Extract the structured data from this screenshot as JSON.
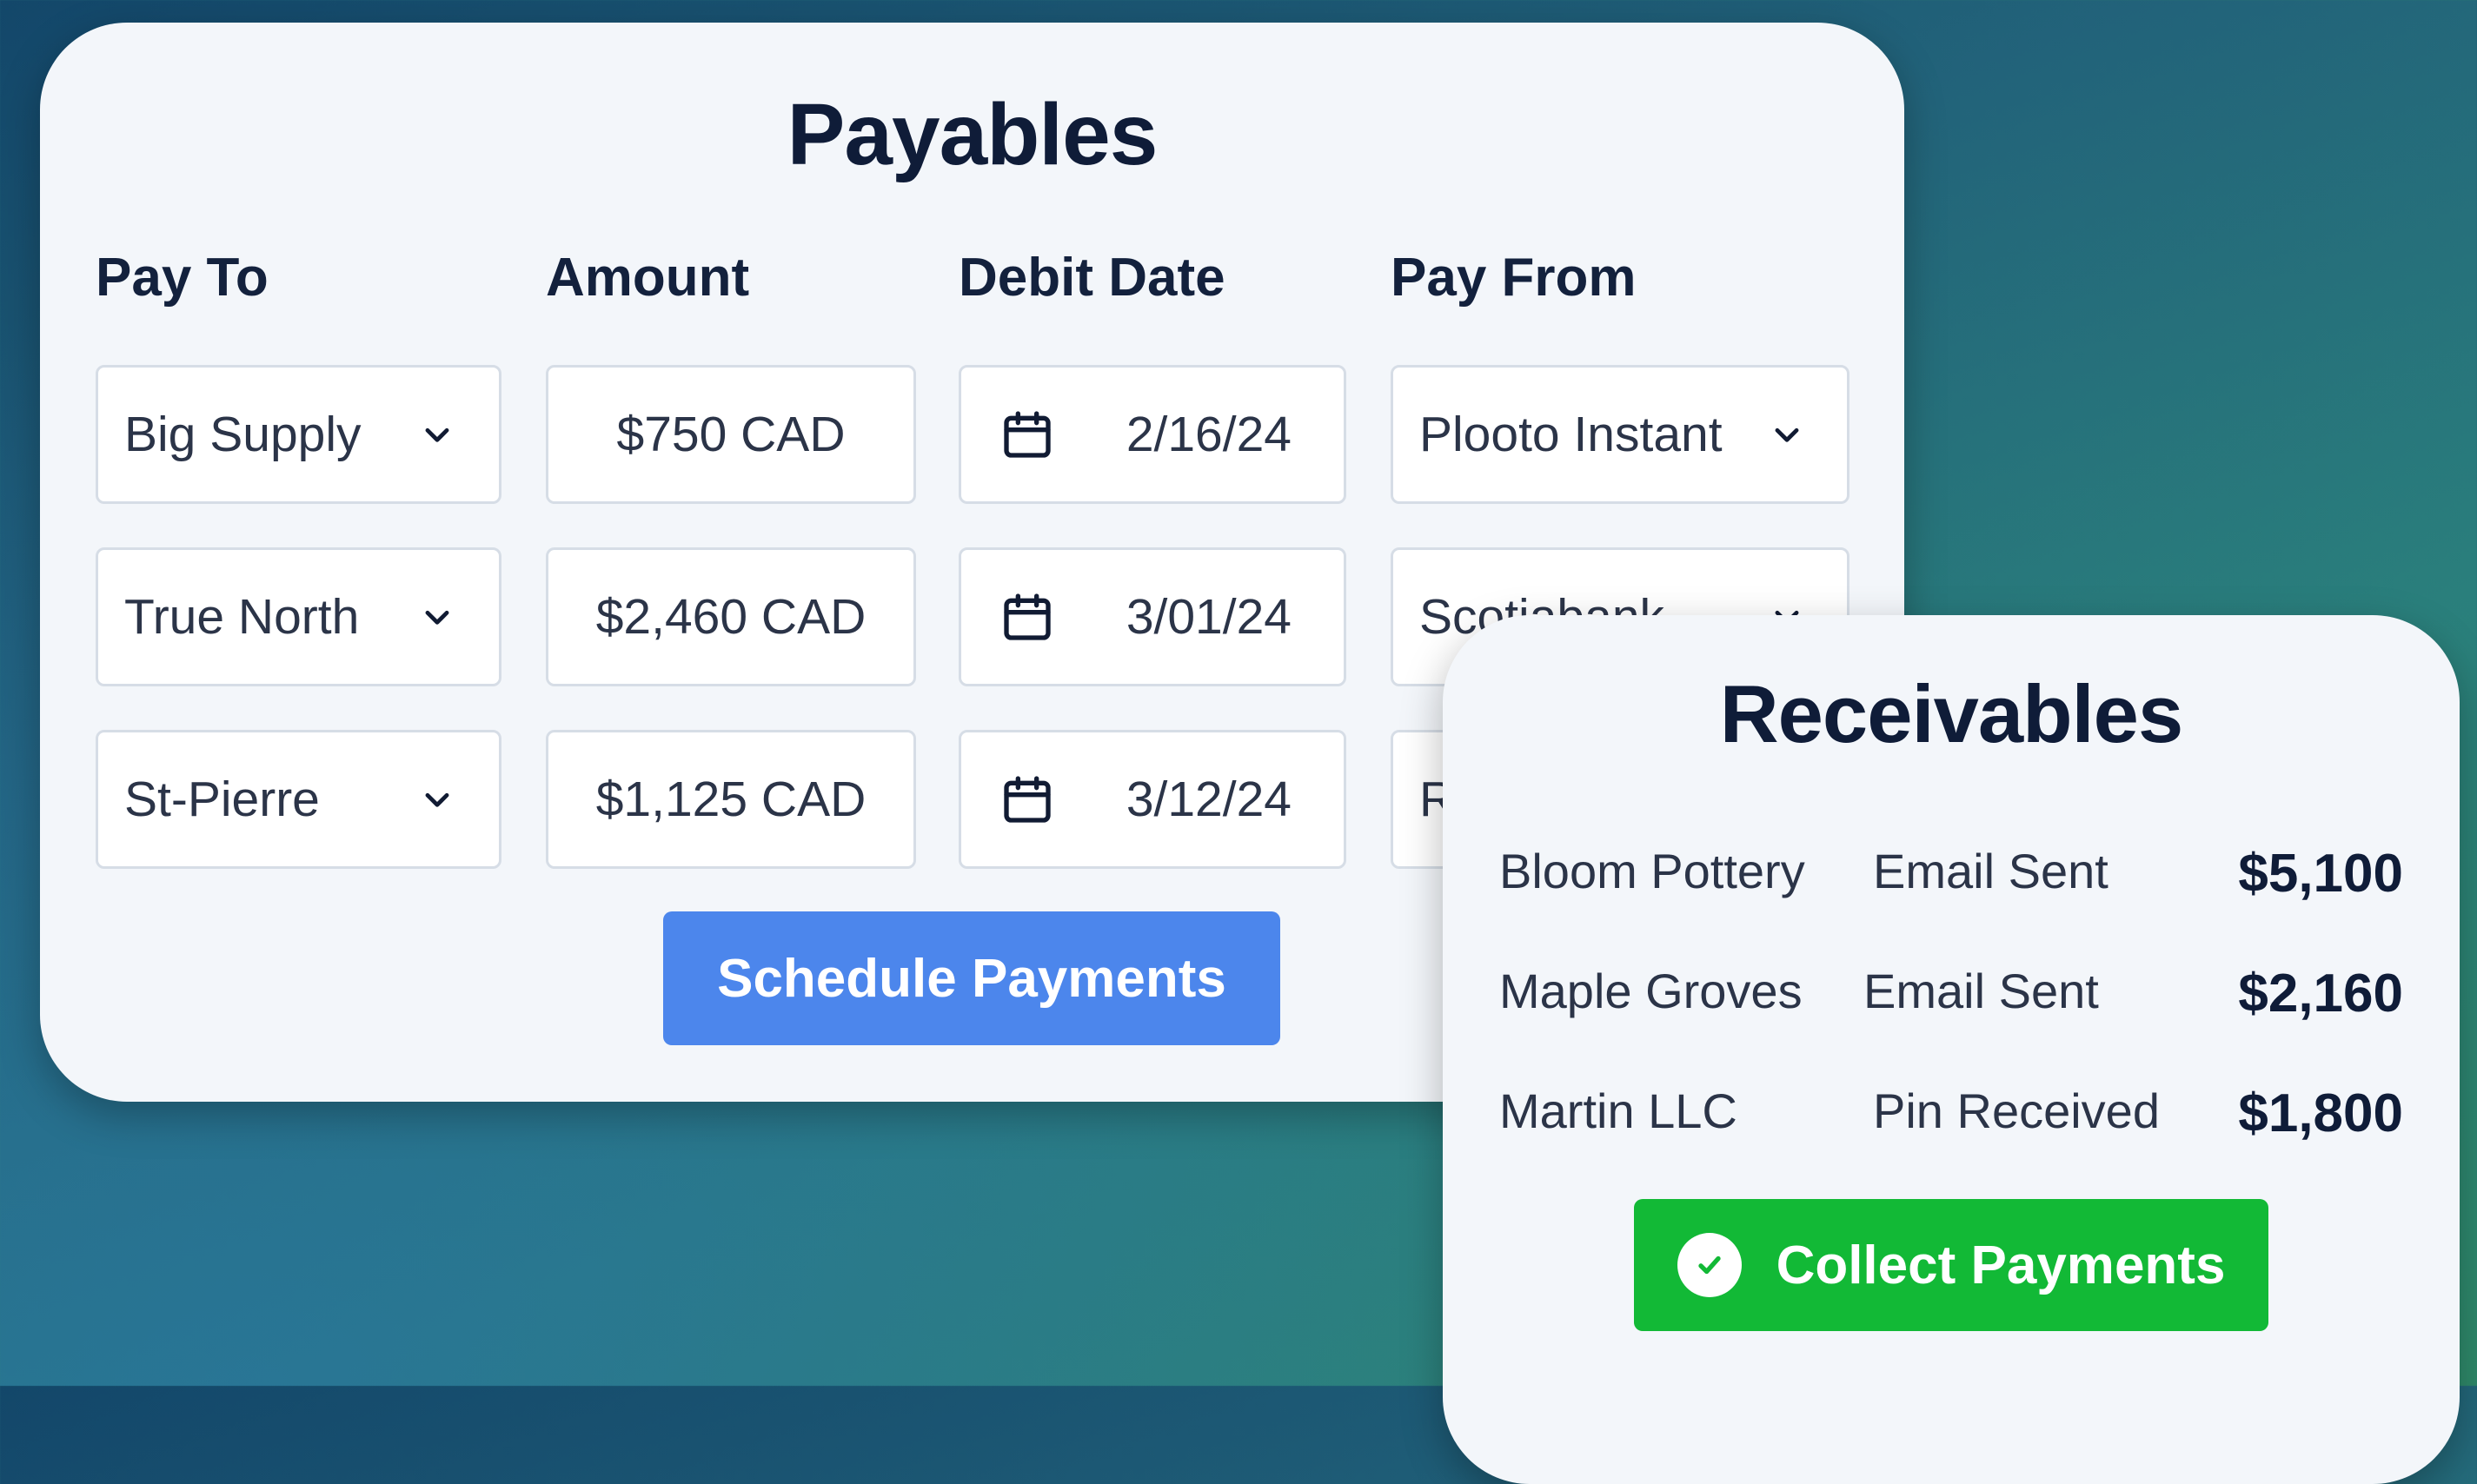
{
  "payables": {
    "title": "Payables",
    "columns": [
      "Pay To",
      "Amount",
      "Debit Date",
      "Pay From"
    ],
    "rows": [
      {
        "pay_to": "Big Supply",
        "amount": "$750 CAD",
        "date": "2/16/24",
        "pay_from": "Plooto Instant"
      },
      {
        "pay_to": "True North",
        "amount": "$2,460 CAD",
        "date": "3/01/24",
        "pay_from": "Scotiabank"
      },
      {
        "pay_to": "St-Pierre",
        "amount": "$1,125 CAD",
        "date": "3/12/24",
        "pay_from": "R"
      }
    ],
    "button_label": "Schedule Payments"
  },
  "receivables": {
    "title": "Receivables",
    "rows": [
      {
        "client": "Bloom Pottery",
        "status": "Email Sent",
        "amount": "$5,100"
      },
      {
        "client": "Maple Groves",
        "status": "Email Sent",
        "amount": "$2,160"
      },
      {
        "client": "Martin LLC",
        "status": "Pin Received",
        "amount": "$1,800"
      }
    ],
    "button_label": "Collect Payments"
  },
  "colors": {
    "primary_button": "#4c86ec",
    "success_button": "#12b936",
    "card_background": "#f3f6fa",
    "heading_text": "#0f1c38"
  },
  "icons": [
    "chevron-down-icon",
    "calendar-icon",
    "check-circle-icon"
  ]
}
